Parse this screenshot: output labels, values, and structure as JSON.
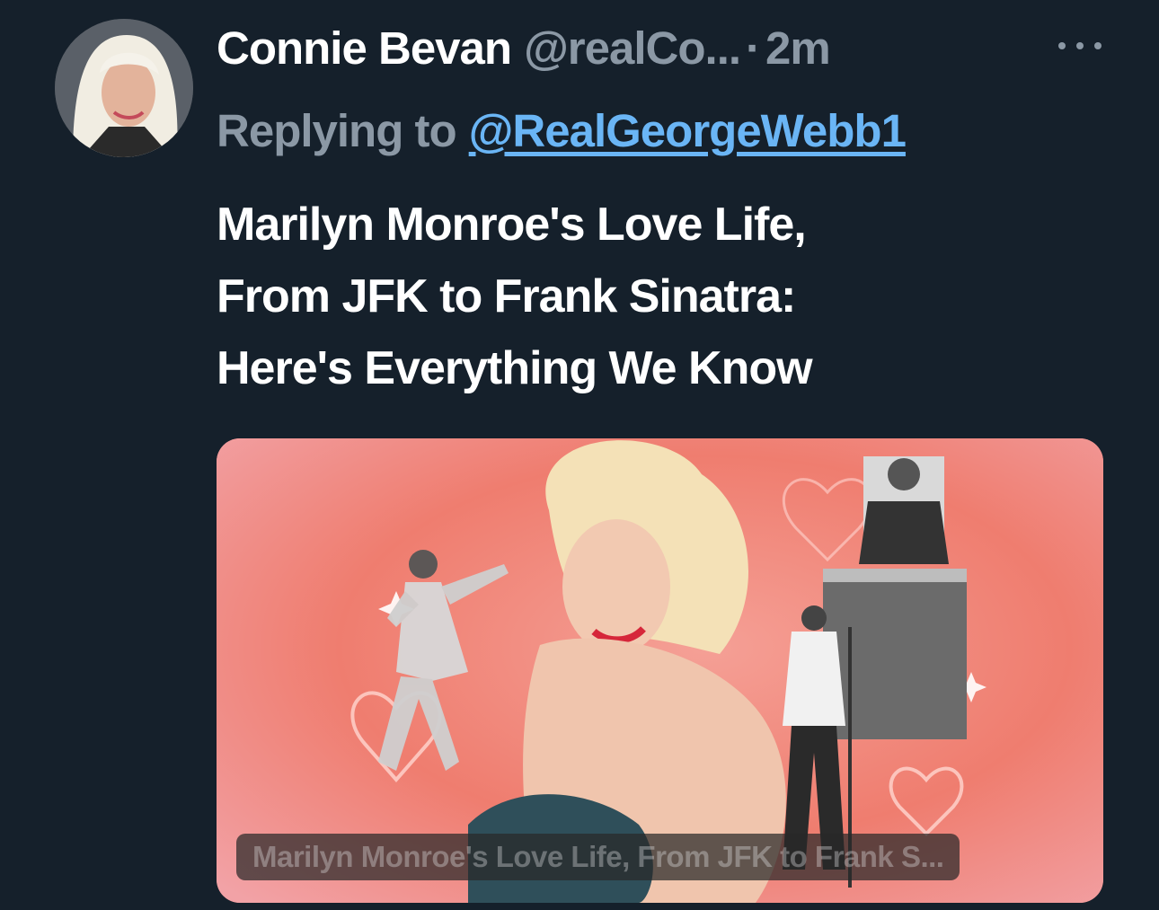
{
  "user": {
    "display_name": "Connie Bevan",
    "handle": "@realCo...",
    "separator": "·",
    "time": "2m"
  },
  "reply": {
    "prefix": "Replying to",
    "mention": "@RealGeorgeWebb1"
  },
  "tweet": {
    "lines": [
      "Marilyn Monroe's Love Life,",
      "From JFK to Frank Sinatra:",
      "Here's Everything We Know"
    ]
  },
  "card": {
    "title": "Marilyn Monroe's Love Life, From JFK to Frank S..."
  },
  "icons": {
    "more": "more-icon",
    "avatar": "avatar-photo"
  },
  "colors": {
    "background": "#15202b",
    "secondary_text": "#8b98a5",
    "link": "#6ab5f5",
    "card_background": "#ee8f87"
  }
}
